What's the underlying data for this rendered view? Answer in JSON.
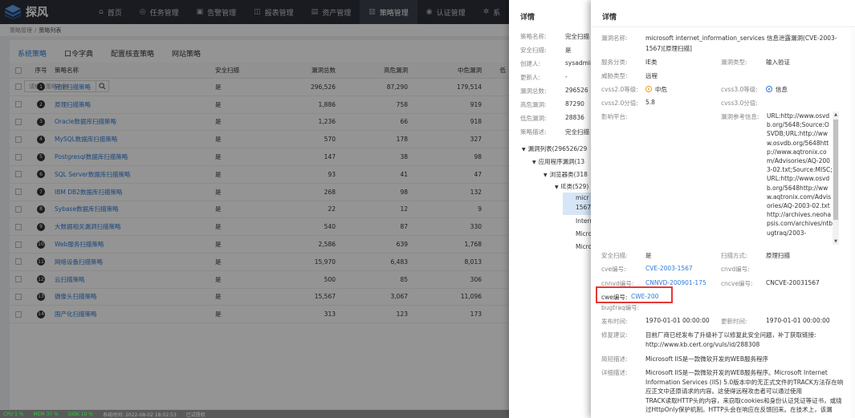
{
  "app": {
    "name": "探风",
    "brand_color": "#2f7bd6"
  },
  "nav": [
    {
      "label": "首页",
      "icon": "home-icon"
    },
    {
      "label": "任务管理",
      "icon": "target-icon"
    },
    {
      "label": "告警管理",
      "icon": "alert-icon"
    },
    {
      "label": "报表管理",
      "icon": "report-icon"
    },
    {
      "label": "资产管理",
      "icon": "asset-icon"
    },
    {
      "label": "策略管理",
      "icon": "policy-icon",
      "active": true
    },
    {
      "label": "认证管理",
      "icon": "auth-icon"
    },
    {
      "label": "系",
      "icon": "gear-icon"
    }
  ],
  "breadcrumb": {
    "parent": "策略管理",
    "sep": "/",
    "current": "策略列表"
  },
  "tabs": [
    "系统策略",
    "口令字典",
    "配置核查策略",
    "网站策略"
  ],
  "search": {
    "placeholder": "请输入策略名称"
  },
  "table": {
    "headers": {
      "no": "序号",
      "name": "策略名称",
      "scan": "安全扫描",
      "total": "漏洞总数",
      "high": "高危漏洞",
      "mid": "中危漏洞",
      "low": "低"
    },
    "rows": [
      {
        "no": "1",
        "name": "完全扫描策略",
        "scan": "是",
        "total": "296,526",
        "high": "87,290",
        "mid": "179,514"
      },
      {
        "no": "2",
        "name": "原理扫描策略",
        "scan": "是",
        "total": "1,886",
        "high": "758",
        "mid": "919"
      },
      {
        "no": "3",
        "name": "Oracle数据库扫描策略",
        "scan": "是",
        "total": "1,236",
        "high": "66",
        "mid": "918"
      },
      {
        "no": "4",
        "name": "MySQL数据库扫描策略",
        "scan": "是",
        "total": "570",
        "high": "178",
        "mid": "327"
      },
      {
        "no": "5",
        "name": "Postgresql数据库扫描策略",
        "scan": "是",
        "total": "147",
        "high": "38",
        "mid": "98"
      },
      {
        "no": "6",
        "name": "SQL Server数据库扫描策略",
        "scan": "是",
        "total": "93",
        "high": "41",
        "mid": "47"
      },
      {
        "no": "7",
        "name": "IBM DB2数据库扫描策略",
        "scan": "是",
        "total": "268",
        "high": "98",
        "mid": "132"
      },
      {
        "no": "8",
        "name": "Sybase数据库扫描策略",
        "scan": "是",
        "total": "22",
        "high": "12",
        "mid": "9"
      },
      {
        "no": "9",
        "name": "大数据相关漏洞扫描策略",
        "scan": "是",
        "total": "540",
        "high": "87",
        "mid": "330"
      },
      {
        "no": "10",
        "name": "Web服务扫描策略",
        "scan": "是",
        "total": "2,586",
        "high": "639",
        "mid": "1,768"
      },
      {
        "no": "11",
        "name": "网络设备扫描策略",
        "scan": "是",
        "total": "15,970",
        "high": "6,483",
        "mid": "8,013"
      },
      {
        "no": "12",
        "name": "云扫描策略",
        "scan": "是",
        "total": "500",
        "high": "85",
        "mid": "306"
      },
      {
        "no": "13",
        "name": "摄像头扫描策略",
        "scan": "是",
        "total": "15,567",
        "high": "3,067",
        "mid": "11,096"
      },
      {
        "no": "14",
        "name": "国产化扫描策略",
        "scan": "是",
        "total": "313",
        "high": "123",
        "mid": "173"
      }
    ]
  },
  "statusbar": {
    "cpu": "CPU 1 %",
    "mem": "MEM 37 %",
    "disk": "DISK 10 %",
    "time": "系统时间: 2022-08-02 18:02:53",
    "license": "已试授权"
  },
  "drawer1": {
    "title": "详情",
    "fields": [
      {
        "k": "策略名称:",
        "v": "完全扫描"
      },
      {
        "k": "安全扫描:",
        "v": "是"
      },
      {
        "k": "创建人:",
        "v": "sysadmin"
      },
      {
        "k": "更新人:",
        "v": "-"
      },
      {
        "k": "漏洞总数:",
        "v": "296526"
      },
      {
        "k": "高危漏洞:",
        "v": "87290"
      },
      {
        "k": "低危漏洞:",
        "v": "28836"
      },
      {
        "k": "策略描述:",
        "v": "完全扫描"
      }
    ],
    "tree": [
      {
        "label": "漏洞列表(296526/29",
        "level": 0
      },
      {
        "label": "应用程序漏洞(13",
        "level": 1
      },
      {
        "label": "浏览器类(318",
        "level": 2
      },
      {
        "label": "IE类(529)",
        "level": 3
      },
      {
        "label": "micr",
        "level": 4
      },
      {
        "label": "1567",
        "level": 4
      },
      {
        "label": "Intern",
        "level": 4
      },
      {
        "label": "Micro",
        "level": 4
      },
      {
        "label": "Micro",
        "level": 4
      }
    ]
  },
  "detail": {
    "title": "详情",
    "vuln_name_label": "漏洞名称:",
    "vuln_name_1": "microsoft internet_information_services 信息泄露漏洞(CVE-2003-",
    "vuln_name_2": "1567)[原理扫描]",
    "service_label": "服务分类:",
    "service": "IE类",
    "vuln_type_label": "漏洞类型:",
    "vuln_type": "输入验证",
    "threat_label": "威胁类型:",
    "threat": "远程",
    "cvss2_level_label": "cvss2.0等级:",
    "cvss2_level": "中危",
    "cvss3_level_label": "cvss3.0等级:",
    "cvss3_level": "信息",
    "cvss2_score_label": "cvss2.0分值:",
    "cvss2_score": "5.8",
    "cvss3_score_label": "cvss3.0分值:",
    "platform_label": "影响平台:",
    "ref_label": "漏洞参考信息:",
    "ref_text": "URL:http://www.osvdb.org/5648;Source:OSVDB;URL:http://www.osvdb.org/5648http://www.aqtronix.com/Advisories/AQ-2003-02.txt;Source:MISC;URL:http://www.osvdb.org/5648http://www.aqtronix.com/Advisories/AQ-2003-02.txthttp://archives.neohapsis.com/archives/ntbugtraq/2003-",
    "safe_scan_label": "安全扫描:",
    "safe_scan": "是",
    "scan_mode_label": "扫描方式:",
    "scan_mode": "原理扫描",
    "cve_label": "cve编号:",
    "cve": "CVE-2003-1567",
    "cnvd_label": "cnvd编号:",
    "cnnvd_label": "cnnvd编号:",
    "cnnvd": "CNNVD-200901-175",
    "cncve_label": "cncve编号:",
    "cncve": "CNCVE-20031567",
    "cwe_label": "cwe编号:",
    "cwe": "CWE-200",
    "bugtraq_label": "bugtraq编号:",
    "publish_label": "发布时间:",
    "publish": "1970-01-01 00:00:00",
    "update_label": "更新时间:",
    "update": "1970-01-01 00:00:00",
    "fix_label": "修复建议:",
    "fix_1": "目前厂商已经发布了升级补丁以修复此安全问题，补丁获取链接:",
    "fix_2": "http://www.kb.cert.org/vuls/id/288308",
    "brief_label": "简短描述:",
    "brief": "Microsoft IIS是一款微软开发的WEB服务程序",
    "detail_label": "详细描述:",
    "detail_1": "Microsoft IIS是一款微软开发的WEB服务程序。Microsoft Internet",
    "detail_2": "Information Services (IIS) 5.0版本中的无正式文件的TRACK方法存在响",
    "detail_3": "应正文中还原请求的内容。这使得远程攻击者可以通过使用",
    "detail_4": "TRACK读取HTTP头的内容，来窃取cookies和身份认证凭证等证书，或绕",
    "detail_5": "过HttpOnly保护机制。HTTP头会在响应在反馈回来。在技术上，该漏"
  },
  "colors": {
    "mid": "#f0a020",
    "info": "#2f7bd6",
    "highlight": "#e53935"
  }
}
